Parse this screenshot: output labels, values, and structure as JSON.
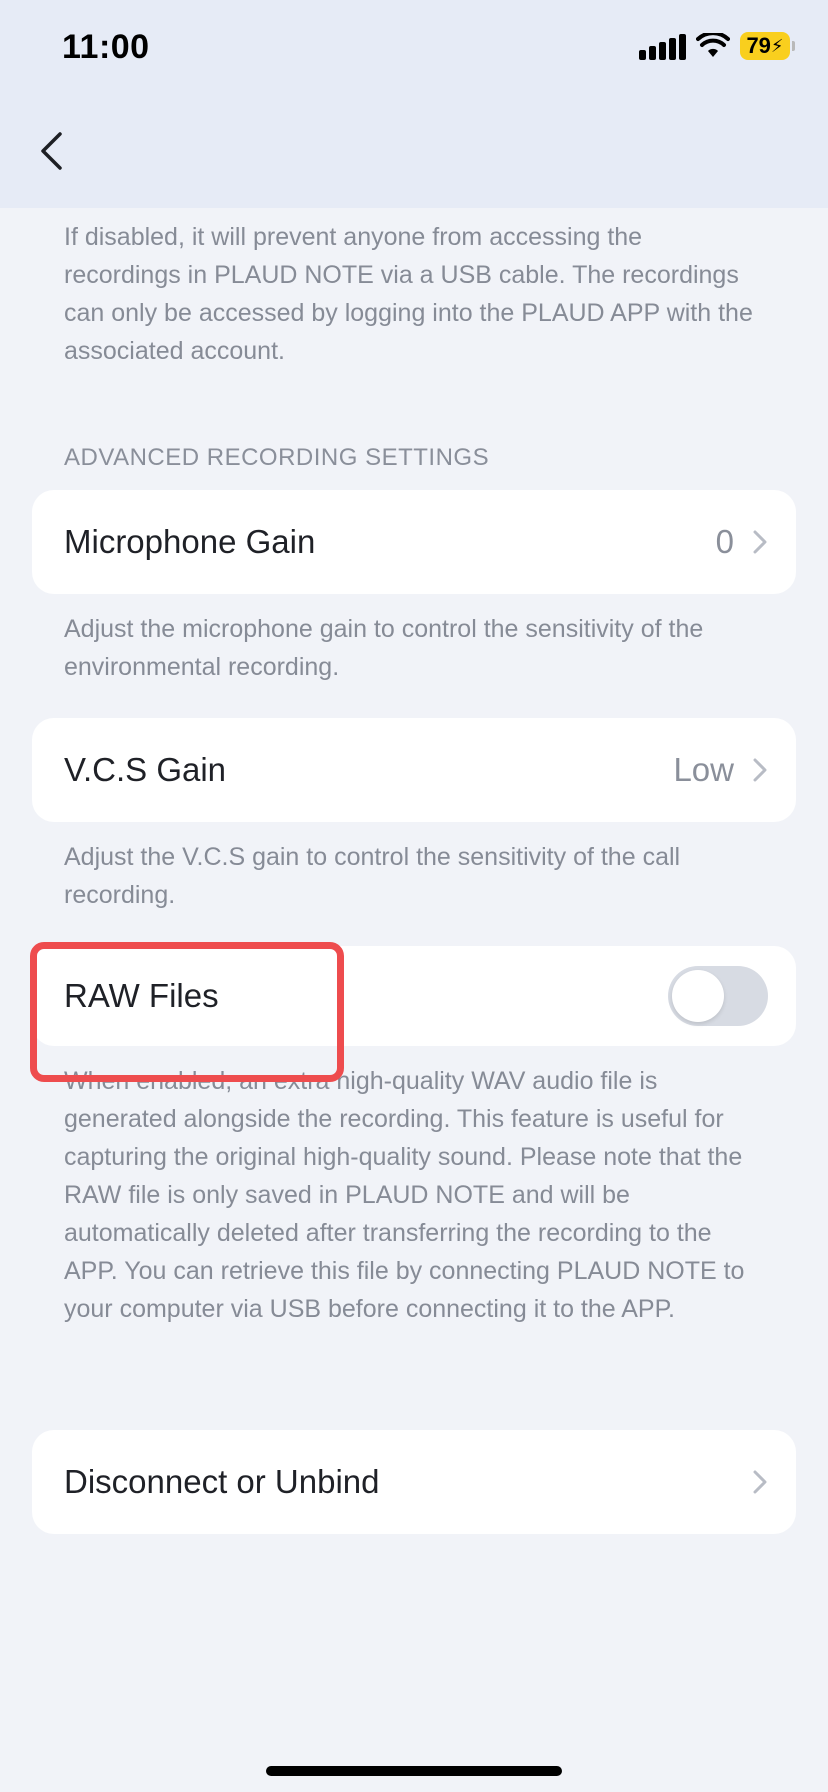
{
  "status_bar": {
    "time": "11:00",
    "battery": "79"
  },
  "usb_note": "If disabled, it will prevent anyone from accessing the recordings in PLAUD NOTE via a USB cable. The recordings can only be accessed by logging into the PLAUD APP with the associated account.",
  "advanced": {
    "section_title": "ADVANCED RECORDING SETTINGS",
    "mic_gain": {
      "label": "Microphone Gain",
      "value": "0",
      "desc": "Adjust the microphone gain to control the sensitivity of the environmental recording."
    },
    "vcs_gain": {
      "label": "V.C.S Gain",
      "value": "Low",
      "desc": "Adjust the V.C.S gain to control the sensitivity of the call recording."
    },
    "raw_files": {
      "label": "RAW Files",
      "enabled": false,
      "desc": "When enabled, an extra high-quality WAV audio file is generated alongside the recording. This feature is useful for capturing the original high-quality sound. Please note that the RAW file is only saved in PLAUD NOTE and will be automatically deleted after transferring the recording to the APP. You can retrieve this file by connecting PLAUD NOTE to your computer via USB before connecting it to the APP."
    }
  },
  "disconnect": {
    "label": "Disconnect or Unbind"
  },
  "colors": {
    "header_bg": "#e6ebf6",
    "page_bg": "#f1f3f8",
    "highlight": "#ee4c4e",
    "battery": "#f9cf1e"
  }
}
